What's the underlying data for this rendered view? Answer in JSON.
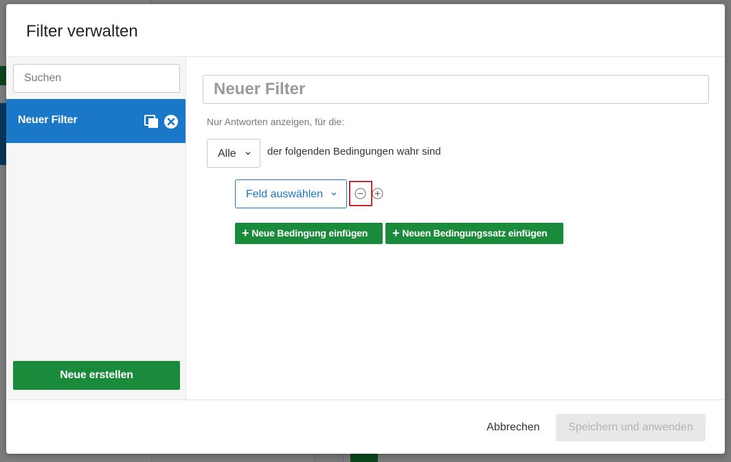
{
  "modal": {
    "title": "Filter verwalten"
  },
  "sidebar": {
    "search_placeholder": "Suchen",
    "selected_filter_label": "Neuer Filter",
    "create_button_label": "Neue erstellen"
  },
  "editor": {
    "filter_name_placeholder": "Neuer Filter",
    "instruction": "Nur Antworten anzeigen, für die:",
    "match_select_value": "Alle",
    "match_text": "der folgenden Bedingungen wahr sind",
    "field_select_value": "Feld auswählen",
    "add_condition_label": "Neue Bedingung einfügen",
    "add_condition_set_label": "Neuen Bedingungssatz einfügen"
  },
  "footer": {
    "cancel_label": "Abbrechen",
    "save_label": "Speichern und anwenden"
  },
  "colors": {
    "accent_blue": "#1b77c7",
    "green": "#1a8b3a",
    "highlight_red": "#c52a33"
  },
  "icons": {
    "copy": "copy-icon",
    "delete": "close-circle-icon",
    "remove_condition": "minus-circle-icon",
    "add_condition": "plus-circle-icon",
    "dropdown": "chevron-down-icon"
  }
}
